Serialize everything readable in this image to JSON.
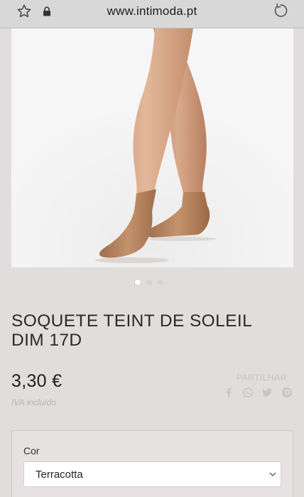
{
  "browser": {
    "url": "www.intimoda.pt",
    "icons": [
      "star-icon",
      "lock-icon",
      "reload-icon"
    ]
  },
  "product": {
    "title": "SOQUETE TEINT DE SOLEIL DIM 17D",
    "price": "3,30 €",
    "vat_note": "IVA incluído",
    "image_alt": "legs wearing sheer tan ankle socks",
    "gallery": {
      "current": 1,
      "total": 3
    }
  },
  "share": {
    "label": "PARTILHAR",
    "icons": [
      "facebook-icon",
      "whatsapp-icon",
      "twitter-icon",
      "pinterest-icon"
    ]
  },
  "options": {
    "color_label": "Cor",
    "color_value": "Terracotta"
  },
  "colors": {
    "background": "#e2dddd",
    "urlbar": "#d8d8d8",
    "muted": "#c6c0c0"
  }
}
